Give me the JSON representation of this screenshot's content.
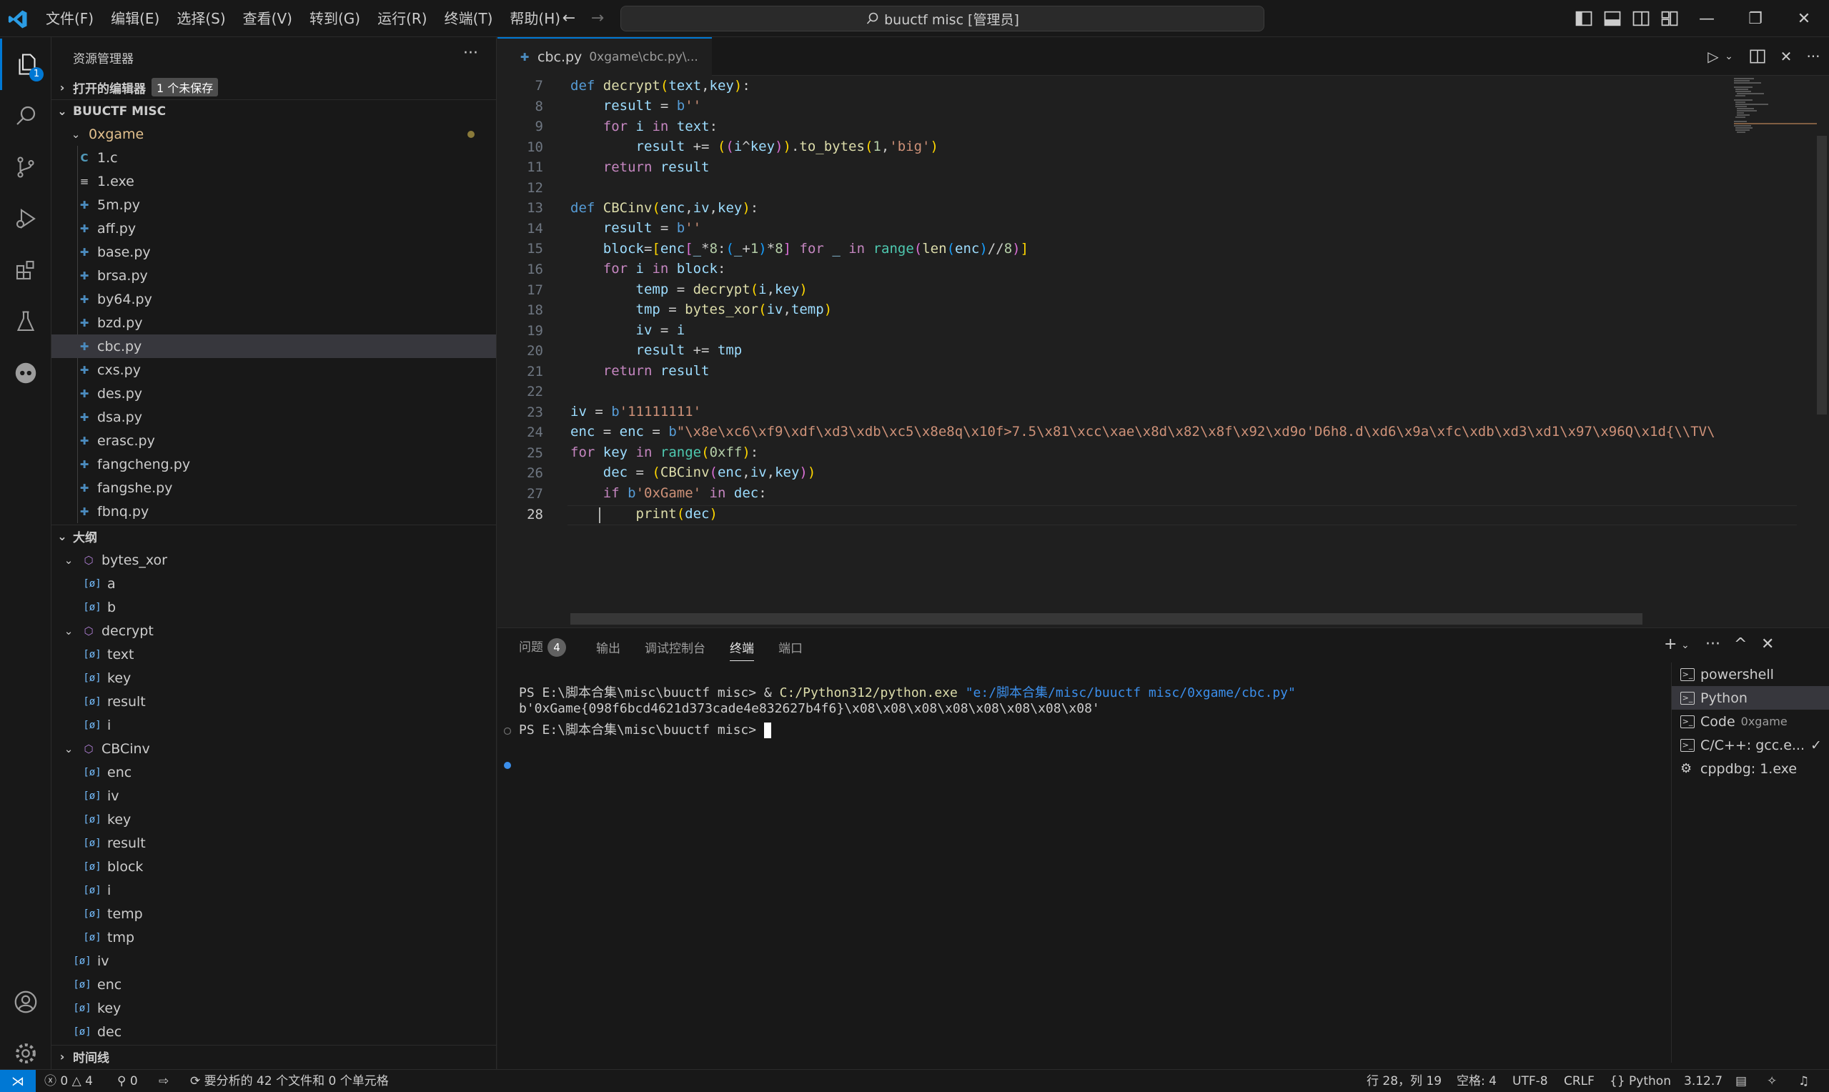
{
  "titlebar": {
    "menus": [
      "文件(F)",
      "编辑(E)",
      "选择(S)",
      "查看(V)",
      "转到(G)",
      "运行(R)",
      "终端(T)",
      "帮助(H)"
    ],
    "search": "buuctf misc [管理员]"
  },
  "activity": {
    "explorer_badge": "1"
  },
  "sidebar": {
    "title": "资源管理器",
    "open_editors": "打开的编辑器",
    "unsaved_badge": "1 个未保存",
    "workspace": "BUUCTF MISC",
    "folder": "0xgame",
    "files": [
      "1.c",
      "1.exe",
      "5m.py",
      "aff.py",
      "base.py",
      "brsa.py",
      "by64.py",
      "bzd.py",
      "cbc.py",
      "cxs.py",
      "des.py",
      "dsa.py",
      "erasc.py",
      "fangcheng.py",
      "fangshe.py",
      "fbnq.py"
    ],
    "outline_title": "大纲",
    "outline": [
      {
        "name": "bytes_xor",
        "level": 0,
        "kind": "fn"
      },
      {
        "name": "a",
        "level": 1,
        "kind": "var"
      },
      {
        "name": "b",
        "level": 1,
        "kind": "var"
      },
      {
        "name": "decrypt",
        "level": 0,
        "kind": "fn"
      },
      {
        "name": "text",
        "level": 1,
        "kind": "var"
      },
      {
        "name": "key",
        "level": 1,
        "kind": "var"
      },
      {
        "name": "result",
        "level": 1,
        "kind": "var"
      },
      {
        "name": "i",
        "level": 1,
        "kind": "var"
      },
      {
        "name": "CBCinv",
        "level": 0,
        "kind": "fn"
      },
      {
        "name": "enc",
        "level": 1,
        "kind": "var"
      },
      {
        "name": "iv",
        "level": 1,
        "kind": "var"
      },
      {
        "name": "key",
        "level": 1,
        "kind": "var"
      },
      {
        "name": "result",
        "level": 1,
        "kind": "var"
      },
      {
        "name": "block",
        "level": 1,
        "kind": "var"
      },
      {
        "name": "i",
        "level": 1,
        "kind": "var"
      },
      {
        "name": "temp",
        "level": 1,
        "kind": "var"
      },
      {
        "name": "tmp",
        "level": 1,
        "kind": "var"
      },
      {
        "name": "iv",
        "level": -1,
        "kind": "var"
      },
      {
        "name": "enc",
        "level": -1,
        "kind": "var"
      },
      {
        "name": "key",
        "level": -1,
        "kind": "var"
      },
      {
        "name": "dec",
        "level": -1,
        "kind": "var"
      }
    ],
    "timeline": "时间线"
  },
  "editor": {
    "tab_name": "cbc.py",
    "tab_path": "0xgame\\cbc.py\\...",
    "line_numbers": [
      "7",
      "8",
      "9",
      "10",
      "11",
      "12",
      "13",
      "14",
      "15",
      "16",
      "17",
      "18",
      "19",
      "20",
      "21",
      "22",
      "23",
      "24",
      "25",
      "26",
      "27",
      "28"
    ],
    "current_line": "28"
  },
  "panel": {
    "tabs": [
      "问题",
      "输出",
      "调试控制台",
      "终端",
      "端口"
    ],
    "problems_count": "4",
    "terminal": {
      "prompt1": "PS E:\\脚本合集\\misc\\buuctf misc> & ",
      "exe": "C:/Python312/python.exe",
      "arg": " \"e:/脚本合集/misc/buuctf misc/0xgame/cbc.py\"",
      "output": "b'0xGame{098f6bcd4621d373cade4e832627b4f6}\\x08\\x08\\x08\\x08\\x08\\x08\\x08\\x08'",
      "prompt2": "PS E:\\脚本合集\\misc\\buuctf misc> "
    },
    "terminals": [
      {
        "name": "powershell",
        "sub": ""
      },
      {
        "name": "Python",
        "sub": ""
      },
      {
        "name": "Code",
        "sub": "0xgame"
      },
      {
        "name": "C/C++: gcc.e...",
        "sub": ""
      },
      {
        "name": "cppdbg: 1.exe",
        "sub": ""
      }
    ]
  },
  "statusbar": {
    "errors": "0",
    "warnings": "4",
    "ports": "0",
    "analysis": "要分析的 42 个文件和 0 个单元格",
    "position": "行 28，列 19",
    "spaces": "空格: 4",
    "encoding": "UTF-8",
    "eol": "CRLF",
    "language": "Python",
    "version": "3.12.7"
  }
}
